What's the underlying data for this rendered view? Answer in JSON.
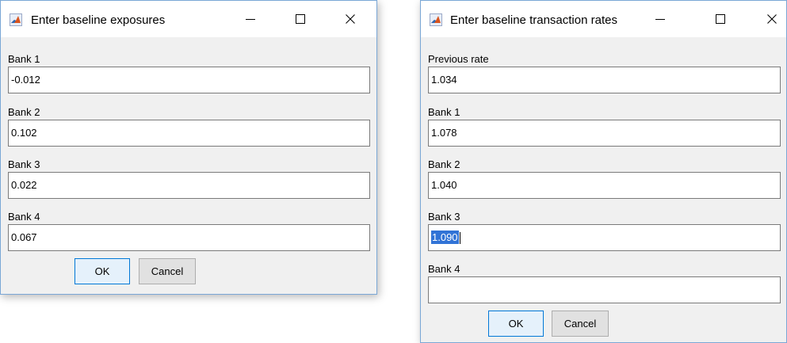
{
  "dialog_exposures": {
    "title": "Enter baseline exposures",
    "fields": [
      {
        "label": "Bank 1",
        "value": "-0.012"
      },
      {
        "label": "Bank 2",
        "value": "0.102"
      },
      {
        "label": "Bank 3",
        "value": "0.022"
      },
      {
        "label": "Bank 4",
        "value": "0.067"
      }
    ],
    "ok_label": "OK",
    "cancel_label": "Cancel"
  },
  "dialog_rates": {
    "title": "Enter baseline transaction rates",
    "fields": [
      {
        "label": "Previous rate",
        "value": "1.034"
      },
      {
        "label": "Bank 1",
        "value": "1.078"
      },
      {
        "label": "Bank 2",
        "value": "1.040"
      },
      {
        "label": "Bank 3",
        "value": "1.090",
        "selected": true
      },
      {
        "label": "Bank 4",
        "value": ""
      }
    ],
    "ok_label": "OK",
    "cancel_label": "Cancel"
  },
  "icons": {
    "app": "matlab-icon",
    "minimize": "minimize-icon",
    "maximize": "maximize-icon",
    "close": "close-icon"
  },
  "colors": {
    "dialog_bg": "#f0f0f0",
    "titlebar_bg": "#ffffff",
    "window_border": "#7aa7d6",
    "selection": "#3173d6",
    "ok_border": "#0078d7",
    "ok_bg": "#e5f1fb"
  }
}
